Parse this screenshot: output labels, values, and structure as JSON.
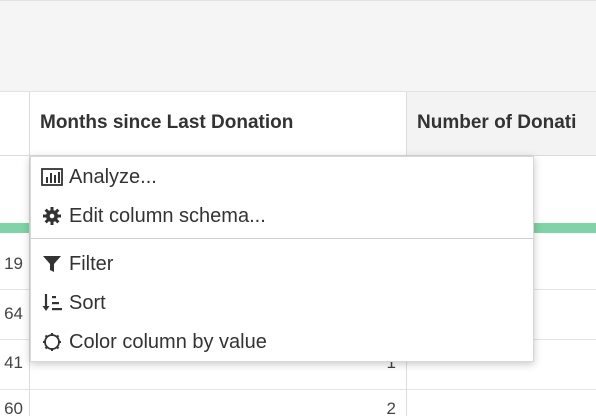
{
  "columns": {
    "months_header": "Months since Last Donation",
    "number_header": "Number of Donati"
  },
  "row_numbers": [
    "19",
    "64",
    "41",
    "60"
  ],
  "cell_values": [
    "1",
    "2"
  ],
  "menu": {
    "items": [
      {
        "label": "Analyze...",
        "icon": "bar-chart-icon"
      },
      {
        "label": "Edit column schema...",
        "icon": "gear-icon"
      },
      {
        "label": "Filter",
        "icon": "filter-icon"
      },
      {
        "label": "Sort",
        "icon": "sort-icon"
      },
      {
        "label": "Color column by value",
        "icon": "color-wheel-icon"
      }
    ]
  },
  "colors": {
    "accent_green": "#7fd3a6",
    "header_bg": "#f3f3f3",
    "topbar_bg": "#f5f5f5"
  }
}
